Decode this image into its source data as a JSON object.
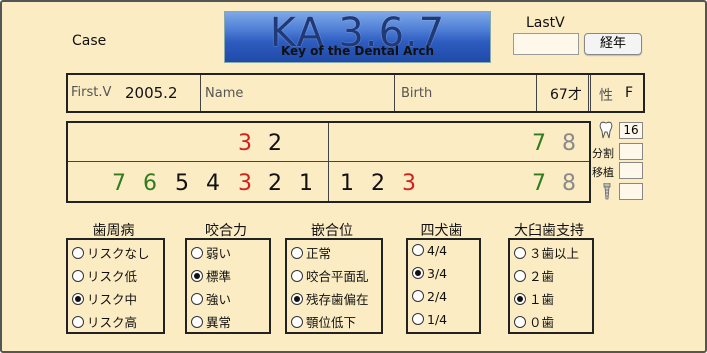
{
  "header": {
    "case_label": "Case",
    "logo_main": "KA 3.6.7",
    "logo_sub": "Key of the Dental Arch",
    "lastv_label": "LastV",
    "lastv_value": "",
    "elapsed_button": "経年"
  },
  "info": {
    "firstv_label": "First.V",
    "firstv_value": "2005.2",
    "name_label": "Name",
    "birth_label": "Birth",
    "age": "67才",
    "sex_label": "性",
    "sex_value": "F"
  },
  "teeth": {
    "upper_right": [
      {
        "n": "3",
        "c": "red"
      },
      {
        "n": "2",
        "c": "blk"
      }
    ],
    "upper_left": [
      {
        "n": "7",
        "c": "green"
      },
      {
        "n": "8",
        "c": "gray"
      }
    ],
    "lower_right": [
      {
        "n": "7",
        "c": "green"
      },
      {
        "n": "6",
        "c": "green"
      },
      {
        "n": "5",
        "c": "blk"
      },
      {
        "n": "4",
        "c": "blk"
      },
      {
        "n": "3",
        "c": "red"
      },
      {
        "n": "2",
        "c": "blk"
      },
      {
        "n": "1",
        "c": "blk"
      }
    ],
    "lower_left": [
      {
        "n": "1",
        "c": "blk"
      },
      {
        "n": "2",
        "c": "blk"
      },
      {
        "n": "3",
        "c": "red"
      },
      {
        "n": "7",
        "c": "green"
      },
      {
        "n": "8",
        "c": "gray"
      }
    ]
  },
  "side": {
    "tooth_count": "16",
    "split_label": "分割",
    "transplant_label": "移植",
    "split_value": "",
    "transplant_value": "",
    "implant_value": ""
  },
  "groups": [
    {
      "title": "歯周病",
      "options": [
        "リスクなし",
        "リスク低",
        "リスク中",
        "リスク高"
      ],
      "selected": 2
    },
    {
      "title": "咬合力",
      "options": [
        "弱い",
        "標準",
        "強い",
        "異常"
      ],
      "selected": 1
    },
    {
      "title": "嵌合位",
      "options": [
        "正常",
        "咬合平面乱",
        "残存歯偏在",
        "顎位低下"
      ],
      "selected": 2
    },
    {
      "title": "四犬歯",
      "options": [
        "4/4",
        "3/4",
        "2/4",
        "1/4"
      ],
      "selected": 1
    },
    {
      "title": "大臼歯支持",
      "options": [
        "３歯以上",
        "２歯",
        "１歯",
        "０歯"
      ],
      "selected": 2
    }
  ],
  "colors": {
    "red": "#d0211f",
    "green": "#2f7d1f",
    "gray": "#8a8a8a"
  }
}
